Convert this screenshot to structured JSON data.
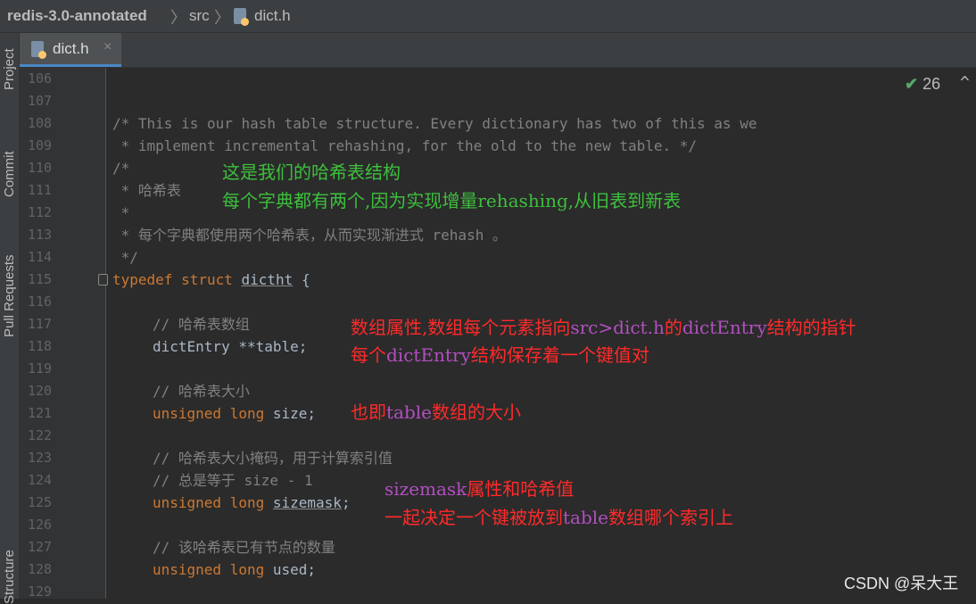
{
  "breadcrumb": {
    "project": "redis-3.0-annotated",
    "folder": "src",
    "file": "dict.h"
  },
  "side_tabs": [
    "Project",
    "Commit",
    "Pull Requests",
    "Structure"
  ],
  "editor_tab": {
    "label": "dict.h",
    "close": "×"
  },
  "inspection": {
    "check": "✔",
    "count": "26",
    "collapse": "^"
  },
  "line_numbers": [
    "106",
    "107",
    "108",
    "109",
    "110",
    "111",
    "112",
    "113",
    "114",
    "115",
    "116",
    "117",
    "118",
    "119",
    "120",
    "121",
    "122",
    "123",
    "124",
    "125",
    "126",
    "127",
    "128",
    "129"
  ],
  "code": {
    "l108": "/* This is our hash table structure. Every dictionary has two of this as we",
    "l109": " * implement incremental rehashing, for the old to the new table. */",
    "l110": "/*",
    "l111": " * 哈希表",
    "l112": " *",
    "l113": " * 每个字典都使用两个哈希表，从而实现渐进式 rehash 。",
    "l114": " */",
    "l115_kw": "typedef struct",
    "l115_name": "dictht",
    "l115_brace": "{",
    "l117": "// 哈希表数组",
    "l118": "dictEntry **table;",
    "l120": "// 哈希表大小",
    "l121_kw": "unsigned long",
    "l121_rest": "size;",
    "l123": "// 哈希表大小掩码，用于计算索引值",
    "l124": "// 总是等于 size - 1",
    "l125_kw": "unsigned long",
    "l125_name": "sizemask",
    "l125_semi": ";",
    "l127": "// 该哈希表已有节点的数量",
    "l128_kw": "unsigned long",
    "l128_rest": "used;"
  },
  "annotations": {
    "a1": "这是我们的哈希表结构",
    "a2": "每个字典都有两个,因为实现增量rehashing,从旧表到新表",
    "a3a": "数组属性,数组每个元素指向",
    "a3b": "src>dict.h",
    "a3c": "的",
    "a3d": "dictEntry",
    "a3e": "结构的指针",
    "a4a": "每个",
    "a4b": "dictEntry",
    "a4c": "结构保存着一个键值对",
    "a5a": "也即",
    "a5b": "table",
    "a5c": "数组的大小",
    "a6a": "sizemask",
    "a6b": "属性和哈希值",
    "a7a": "一起决定一个键被放到",
    "a7b": "table",
    "a7c": "数组哪个索引上"
  },
  "watermark": "CSDN @呆大王",
  "colors": {
    "annotation_green": "#3dbf3d",
    "annotation_red": "#ff2a2a",
    "annotation_purple": "#b34fc2",
    "keyword": "#cc7832",
    "comment": "#808080"
  }
}
